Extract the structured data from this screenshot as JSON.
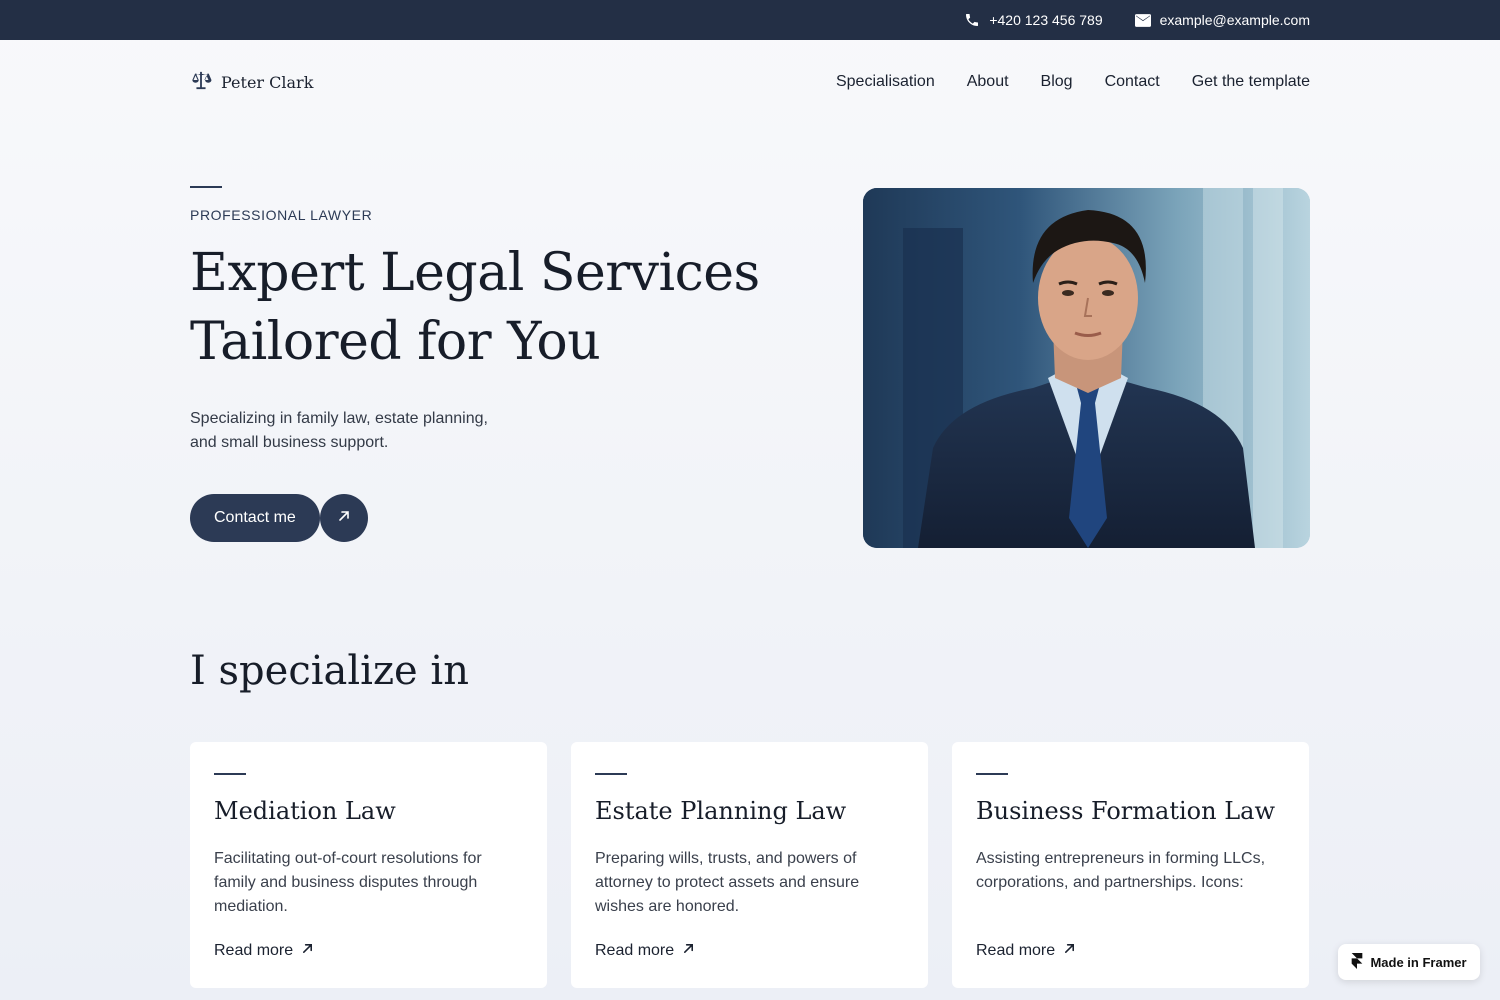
{
  "topbar": {
    "phone": "+420 123 456 789",
    "email": "example@example.com"
  },
  "brand": {
    "name": "Peter Clark",
    "icon": "scales-icon"
  },
  "nav": {
    "items": [
      "Specialisation",
      "About",
      "Blog",
      "Contact",
      "Get the template"
    ]
  },
  "hero": {
    "eyebrow": "PROFESSIONAL LAWYER",
    "title_line1": "Expert Legal Services",
    "title_line2": "Tailored for You",
    "subtitle": "Specializing in family law, estate planning, and small business support.",
    "cta_label": "Contact me",
    "photo": "portrait-photo"
  },
  "specialize": {
    "title": "I specialize in",
    "cards": [
      {
        "title": "Mediation Law",
        "desc": "Facilitating out-of-court resolutions for family and business disputes through mediation.",
        "link": "Read more"
      },
      {
        "title": "Estate Planning Law",
        "desc": "Preparing wills, trusts, and powers of attorney to protect assets and ensure wishes are honored.",
        "link": "Read more"
      },
      {
        "title": "Business Formation Law",
        "desc": "Assisting entrepreneurs in forming LLCs, corporations, and partnerships. Icons:",
        "link": "Read more"
      }
    ]
  },
  "badge": {
    "label": "Made in Framer"
  },
  "colors": {
    "topbar": "#232f45",
    "accent": "#2c3a55",
    "text": "#171d29",
    "card": "#ffffff"
  }
}
